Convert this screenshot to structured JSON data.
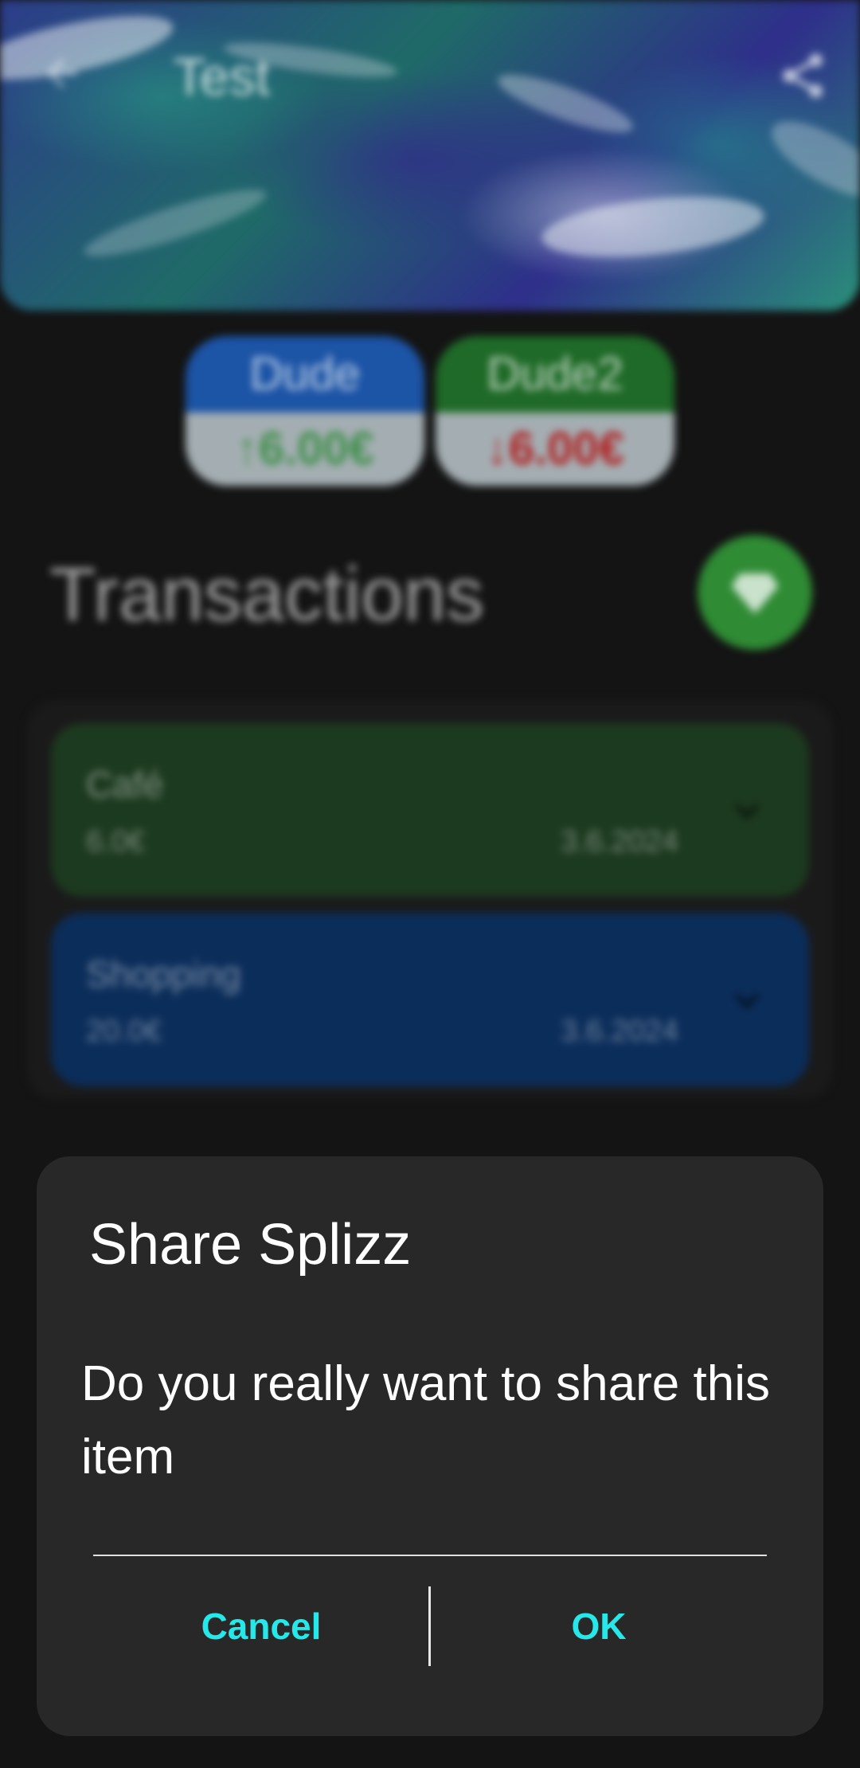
{
  "header": {
    "title": "Test",
    "back_icon": "arrow-left-icon",
    "share_icon": "share-icon"
  },
  "participants": [
    {
      "name": "Dude",
      "amount": "6.00€",
      "direction": "up",
      "color": "#1c54a6",
      "amount_color": "#3f8f4a"
    },
    {
      "name": "Dude2",
      "amount": "6.00€",
      "direction": "down",
      "color": "#1f6a28",
      "amount_color": "#b02020"
    }
  ],
  "transactions_section": {
    "title": "Transactions",
    "add_icon": "diamond-icon"
  },
  "transactions": [
    {
      "name": "Café",
      "amount": "6.0€",
      "date": "3.6.2024",
      "color": "#1c3a1f"
    },
    {
      "name": "Shopping",
      "amount": "20.0€",
      "date": "3.6.2024",
      "color": "#0b2d5a"
    }
  ],
  "dialog": {
    "title": "Share Splizz",
    "message": "Do you really want to share this item",
    "cancel_label": "Cancel",
    "ok_label": "OK",
    "accent_color": "#26e8e8"
  }
}
